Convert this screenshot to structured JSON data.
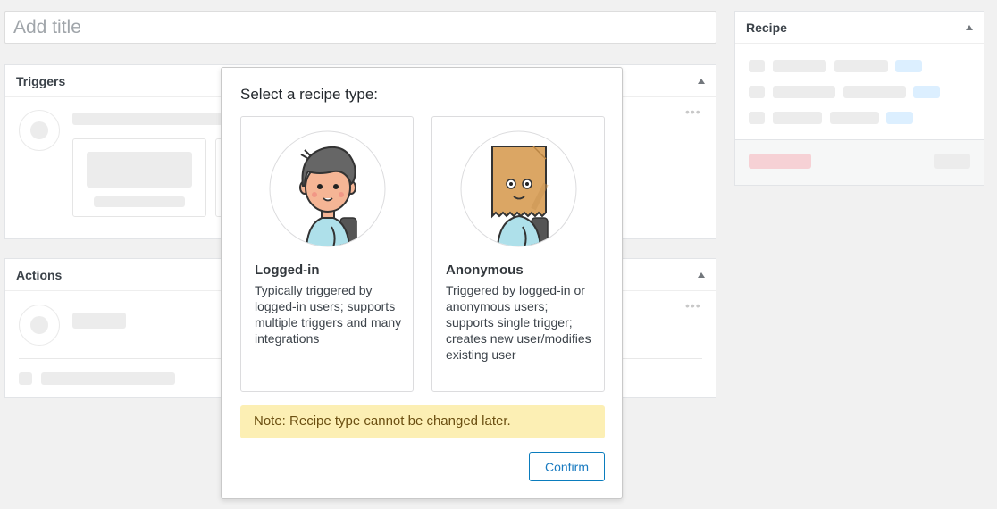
{
  "title_input": {
    "placeholder": "Add title"
  },
  "triggers": {
    "heading": "Triggers"
  },
  "actions": {
    "heading": "Actions"
  },
  "recipe_panel": {
    "heading": "Recipe"
  },
  "modal": {
    "title": "Select a recipe type:",
    "options": [
      {
        "title": "Logged-in",
        "description": "Typically triggered by logged-in users; supports multiple triggers and many integrations",
        "icon": "user-avatar-icon"
      },
      {
        "title": "Anonymous",
        "description": "Triggered by logged-in or anonymous users; supports single trigger; creates new user/modifies existing user",
        "icon": "paper-bag-avatar-icon"
      }
    ],
    "note": "Note: Recipe type cannot be changed later.",
    "confirm_label": "Confirm"
  },
  "colors": {
    "note_bg": "#fcefb4",
    "confirm_accent": "#0a7cbd",
    "page_bg": "#f1f1f1"
  }
}
